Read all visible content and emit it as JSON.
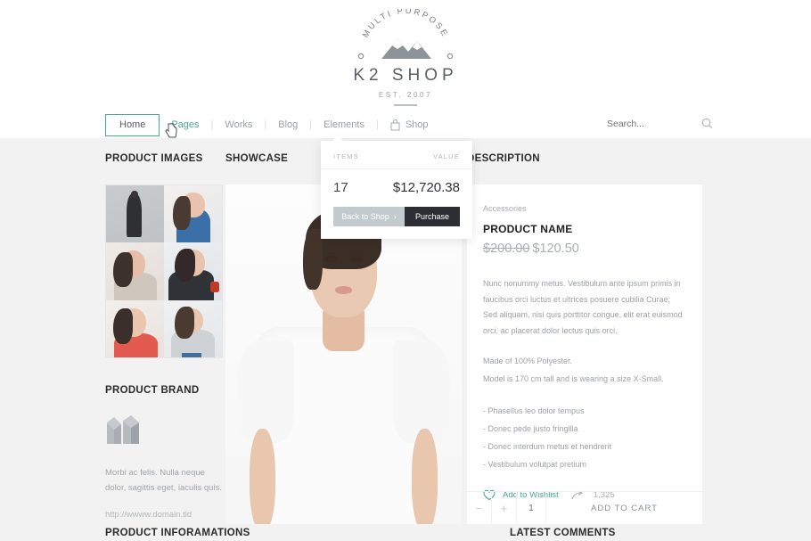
{
  "brand": {
    "arc_text": "MULTI PURPOSE",
    "name": "K2 SHOP",
    "established": "EST. 2007"
  },
  "nav": {
    "home": "Home",
    "items": [
      {
        "label": "Pages",
        "active": true
      },
      {
        "label": "Works",
        "active": false
      },
      {
        "label": "Blog",
        "active": false
      },
      {
        "label": "Elements",
        "active": false
      }
    ],
    "separator": "|",
    "shop": "Shop",
    "shop_icon": "shopping-bag-icon"
  },
  "search": {
    "placeholder": "Search...",
    "value": "",
    "icon": "search-icon"
  },
  "cart_dropdown": {
    "header_items": "ITEMS",
    "header_value": "VALUE",
    "items_count": "17",
    "total_value": "$12,720.38",
    "back_label": "Back to Shop",
    "back_chevron": "›",
    "purchase_label": "Purchase"
  },
  "sections": {
    "product_images": "PRODUCT IMAGES",
    "showcase": "SHOWCASE",
    "description": "DESCRIPTION",
    "product_brand": "PRODUCT BRAND",
    "product_informations": "PRODUCT INFORAMATIONS",
    "latest_comments": "LATEST COMMENTS"
  },
  "brand_block": {
    "logo_icon": "mm-monogram-logo",
    "text": "Morbi ac felis. Nulla neque dolor, sagittis eget, iaculis quis.",
    "link": "http://wwww.domain.tld"
  },
  "product": {
    "category": "Accessories",
    "name": "PRODUCT NAME",
    "price_old": "$200.00",
    "price_new": "$120.50",
    "description": "Nunc nonummy metus. Vestibulum ante ipsum primis in faucibus orci luctus et ultrices posuere cubilia Curae; Sed aliquam, nisi quis porttitor congue, elit erat euismod orci, ac placerat dolor lectus quis orci.",
    "material": "Made of 100% Polyester.",
    "model_note": "Model is 170 cm tall and is wearing a size X-Small.",
    "bullets": [
      "- Phasellus leo dolor tempus",
      "- Donec pede justo fringilla",
      "- Donec interdum metus et hendrerit",
      "- Vestibulum volutpat pretium"
    ],
    "wishlist_label": "Add to Wishlist",
    "wishlist_icon": "heart-icon",
    "share_icon": "share-arrow-icon",
    "share_count": "1,325",
    "qty_minus": "−",
    "qty_plus": "+",
    "qty_value": "1",
    "add_to_cart": "ADD TO CART"
  },
  "colors": {
    "accent": "#4aa890",
    "page_bg": "#f2f2f2",
    "card_bg": "#ffffff",
    "dark_button": "#2b2f33",
    "muted_button": "#c2cace",
    "text_dark": "#222222",
    "text_muted": "#9da2a7"
  }
}
